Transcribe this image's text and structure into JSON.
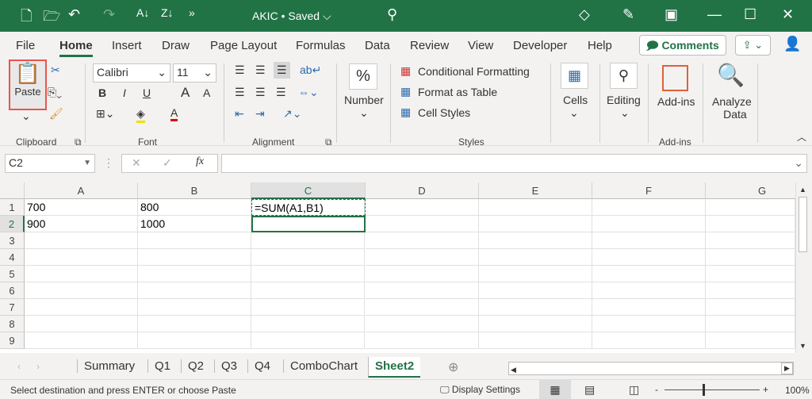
{
  "titlebar": {
    "title": "AKIC • Saved ⌵",
    "qa_icons": [
      "new-file-icon",
      "open-icon",
      "undo-icon",
      "redo-icon",
      "sort-az-icon",
      "sort-za-icon",
      "more-icon"
    ]
  },
  "menu": [
    "File",
    "Home",
    "Insert",
    "Draw",
    "Page Layout",
    "Formulas",
    "Data",
    "Review",
    "View",
    "Developer",
    "Help"
  ],
  "comments_label": "Comments",
  "ribbon": {
    "clipboard": {
      "paste": "Paste",
      "group": "Clipboard"
    },
    "font": {
      "name": "Calibri",
      "size": "11",
      "group": "Font",
      "bold": "B",
      "italic": "I",
      "underline": "U",
      "grow": "A",
      "shrink": "A",
      "font_color": "A"
    },
    "alignment": {
      "group": "Alignment"
    },
    "number": {
      "label": "Number",
      "symbol": "%"
    },
    "styles": {
      "cond": "Conditional Formatting",
      "table": "Format as Table",
      "cell_styles": "Cell Styles",
      "group": "Styles"
    },
    "cells": "Cells",
    "editing": "Editing",
    "addins": "Add-ins",
    "addins_group": "Add-ins",
    "analyze": "Analyze",
    "analyze2": "Data"
  },
  "formula_bar": {
    "name_box": "C2",
    "fx": "fx",
    "value": ""
  },
  "columns": [
    "A",
    "B",
    "C",
    "D",
    "E",
    "F",
    "G"
  ],
  "rows": [
    "1",
    "2",
    "3",
    "4",
    "5",
    "6",
    "7",
    "8",
    "9"
  ],
  "cells": {
    "A1": "700",
    "B1": "800",
    "C1": "=SUM(A1,B1)",
    "A2": "900",
    "B2": "1000"
  },
  "sheets": [
    "Summary",
    "Q1",
    "Q2",
    "Q3",
    "Q4",
    "ComboChart",
    "Sheet2"
  ],
  "active_sheet": "Sheet2",
  "status": {
    "message": "Select destination and press ENTER or choose Paste",
    "display_settings": "Display Settings",
    "zoom": "100%",
    "zoom_minus": "-",
    "zoom_plus": "+"
  }
}
